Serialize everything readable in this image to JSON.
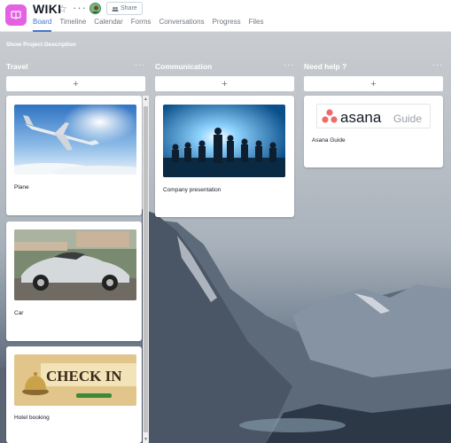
{
  "header": {
    "title": "WIKI",
    "share_label": "Share",
    "tabs": [
      "Board",
      "Timeline",
      "Calendar",
      "Forms",
      "Conversations",
      "Progress",
      "Files"
    ],
    "active_tab": "Board"
  },
  "board": {
    "show_description": "Show Project Description",
    "add_symbol": "+",
    "more_symbol": "···",
    "columns": [
      {
        "title": "Travel",
        "cards": [
          {
            "label": "Plane"
          },
          {
            "label": "Car"
          },
          {
            "label": "Hotel booking"
          }
        ]
      },
      {
        "title": "Communication",
        "cards": [
          {
            "label": "Company presentation"
          }
        ]
      },
      {
        "title": "Need help ?",
        "cards": [
          {
            "label": "Asana Guide",
            "logo_word": "asana",
            "logo_suffix": "Guide"
          }
        ]
      }
    ],
    "hotel_sign_text": "CHECK IN"
  },
  "colors": {
    "accent": "#4573d2",
    "project_icon": "#e362e3",
    "asana_coral": "#f06a6a"
  },
  "icons": [
    "project-icon",
    "star-icon",
    "more-icon",
    "avatar",
    "share-icon",
    "plus-icon"
  ]
}
